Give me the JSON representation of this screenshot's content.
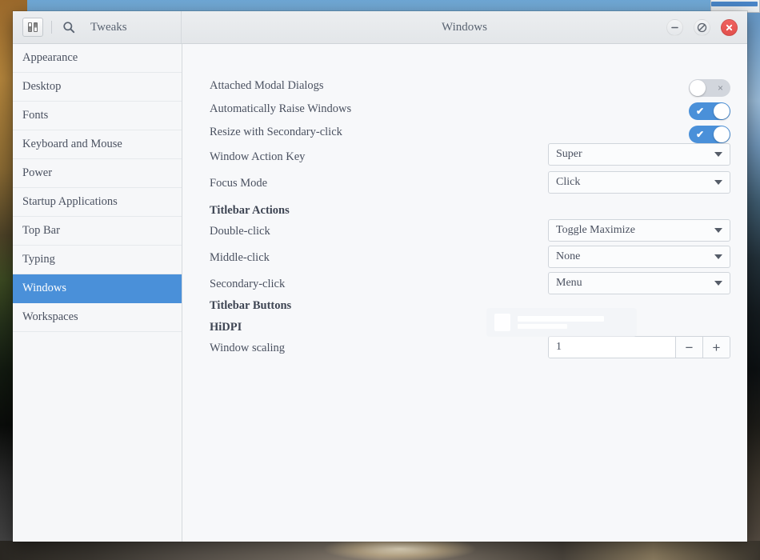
{
  "window": {
    "title": "Windows",
    "app_name": "Tweaks",
    "icons": {
      "app_icon": "tweaks-switches-icon",
      "search_icon": "search-icon",
      "minimize_icon": "minimize-icon",
      "maximize_icon": "maximize-restore-icon",
      "close_icon": "close-icon"
    },
    "controls": {
      "minimize_label": "−",
      "maximize_label": "⊘",
      "close_label": "✕"
    }
  },
  "colors": {
    "accent": "#4a90d9",
    "close_button": "#e2504d",
    "header_bg": "#e3e6e9",
    "content_bg": "#f7f8fa",
    "sidebar_bg": "#f6f7f9",
    "text": "#4a5160"
  },
  "sidebar": {
    "selected": "Windows",
    "items": [
      {
        "label": "Appearance"
      },
      {
        "label": "Desktop"
      },
      {
        "label": "Fonts"
      },
      {
        "label": "Keyboard and Mouse"
      },
      {
        "label": "Power"
      },
      {
        "label": "Startup Applications"
      },
      {
        "label": "Top Bar"
      },
      {
        "label": "Typing"
      },
      {
        "label": "Windows"
      },
      {
        "label": "Workspaces"
      }
    ]
  },
  "settings": {
    "attached_modal_dialogs": {
      "label": "Attached Modal Dialogs",
      "state": "off",
      "mark": "×"
    },
    "automatically_raise_windows": {
      "label": "Automatically Raise Windows",
      "state": "on",
      "mark": "✔"
    },
    "resize_with_secondary_click": {
      "label": "Resize with Secondary-click",
      "state": "on",
      "mark": "✔"
    },
    "window_action_key": {
      "label": "Window Action Key",
      "value": "Super"
    },
    "focus_mode": {
      "label": "Focus Mode",
      "value": "Click"
    },
    "titlebar_actions_header": {
      "label": "Titlebar Actions"
    },
    "double_click": {
      "label": "Double-click",
      "value": "Toggle Maximize"
    },
    "middle_click": {
      "label": "Middle-click",
      "value": "None"
    },
    "secondary_click": {
      "label": "Secondary-click",
      "value": "Menu"
    },
    "titlebar_buttons_header": {
      "label": "Titlebar Buttons"
    },
    "hidpi_header": {
      "label": "HiDPI"
    },
    "window_scaling": {
      "label": "Window scaling",
      "value": "1",
      "minus_label": "−",
      "plus_label": "+"
    }
  }
}
